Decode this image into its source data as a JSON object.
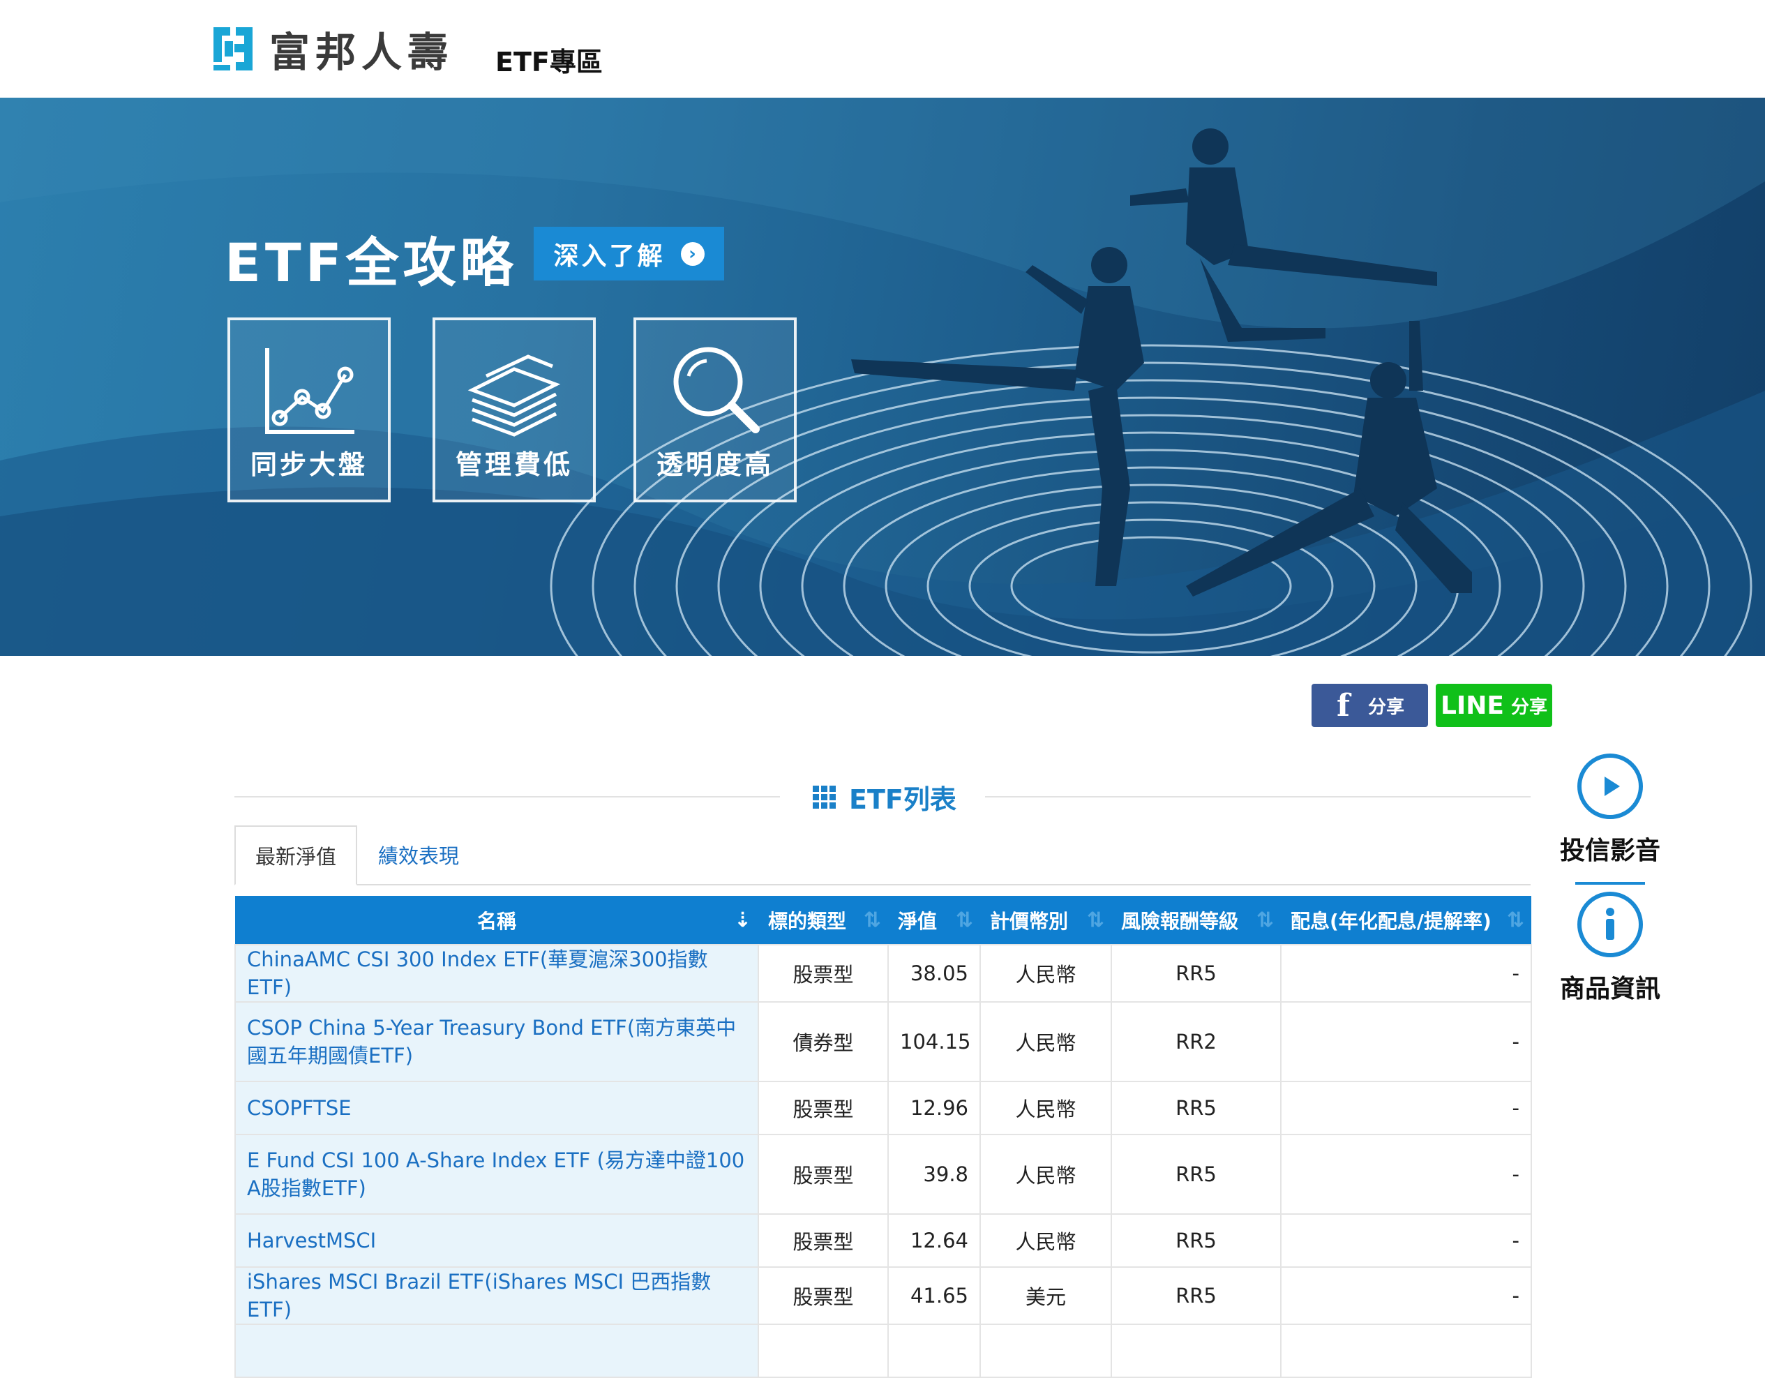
{
  "header": {
    "brand": "富邦人壽",
    "nav_label": "ETF專區"
  },
  "banner": {
    "title": "ETF全攻略",
    "cta_label": "深入了解",
    "features": [
      {
        "label": "同步大盤",
        "icon": "line-chart-icon"
      },
      {
        "label": "管理費低",
        "icon": "money-stack-icon"
      },
      {
        "label": "透明度高",
        "icon": "magnifier-icon"
      }
    ]
  },
  "share": {
    "facebook_label": "分享",
    "line_brand": "LINE",
    "line_label": "分享"
  },
  "section": {
    "title": "ETF列表"
  },
  "tabs": [
    {
      "label": "最新淨值",
      "active": true
    },
    {
      "label": "績效表現",
      "active": false
    }
  ],
  "table": {
    "columns": [
      "名稱",
      "標的類型",
      "淨值",
      "計價幣別",
      "風險報酬等級",
      "配息(年化配息/提解率)"
    ],
    "rows": [
      {
        "name": "ChinaAMC CSI 300 Index ETF(華夏滬深300指數 ETF)",
        "type": "股票型",
        "nav": "38.05",
        "currency": "人民幣",
        "risk": "RR5",
        "dividend": "-"
      },
      {
        "name": "CSOP China 5-Year Treasury Bond ETF(南方東英中國五年期國債ETF)",
        "type": "債券型",
        "nav": "104.15",
        "currency": "人民幣",
        "risk": "RR2",
        "dividend": "-"
      },
      {
        "name": "CSOPFTSE",
        "type": "股票型",
        "nav": "12.96",
        "currency": "人民幣",
        "risk": "RR5",
        "dividend": "-"
      },
      {
        "name": "E Fund CSI 100 A-Share Index ETF (易方達中證100 A股指數ETF)",
        "type": "股票型",
        "nav": "39.8",
        "currency": "人民幣",
        "risk": "RR5",
        "dividend": "-"
      },
      {
        "name": "HarvestMSCI",
        "type": "股票型",
        "nav": "12.64",
        "currency": "人民幣",
        "risk": "RR5",
        "dividend": "-"
      },
      {
        "name": "iShares MSCI Brazil ETF(iShares MSCI 巴西指數ETF)",
        "type": "股票型",
        "nav": "41.65",
        "currency": "美元",
        "risk": "RR5",
        "dividend": "-"
      }
    ]
  },
  "side": {
    "video_label": "投信影音",
    "info_label": "商品資訊"
  },
  "colors": {
    "brand_blue": "#0f7fd0",
    "link_blue": "#1a6fc2",
    "facebook": "#3b5998",
    "line_green": "#10c019",
    "row_highlight": "#e8f4fb"
  }
}
